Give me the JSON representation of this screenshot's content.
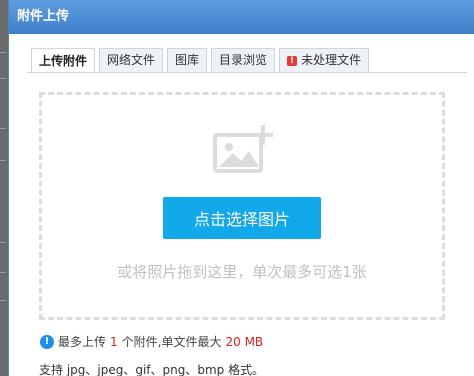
{
  "dialog": {
    "title": "附件上传"
  },
  "tabs": [
    {
      "label": "上传附件",
      "active": true
    },
    {
      "label": "网络文件"
    },
    {
      "label": "图库"
    },
    {
      "label": "目录浏览"
    },
    {
      "label": "未处理文件",
      "icon": "warning-icon"
    }
  ],
  "upload": {
    "button_label": "点击选择图片",
    "drop_hint": "或将照片拖到这里，单次最多可选1张"
  },
  "limits": {
    "text_prefix": "最多上传",
    "max_count": "1",
    "text_mid": "个附件,单文件最大",
    "max_size": "20 MB"
  },
  "formats_text": "支持 jpg、jpeg、gif、png、bmp 格式。",
  "colors": {
    "title_bar": "#4a8ad4",
    "button": "#12a9ea",
    "highlight": "#e02020",
    "warning": "#e53935",
    "info": "#1a8ee8"
  }
}
